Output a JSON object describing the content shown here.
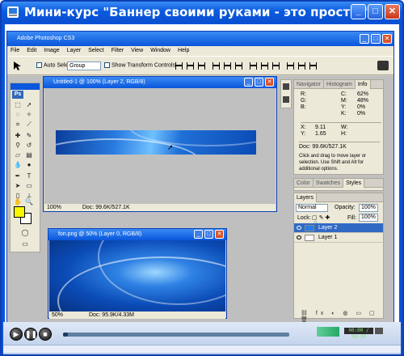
{
  "outer_window": {
    "title": "Мини-курс \"Баннер своими руками - это просто!\"",
    "buttons": [
      "_",
      "□",
      "✕"
    ]
  },
  "photoshop": {
    "title": "Adobe Photoshop CS3",
    "buttons": [
      "_",
      "□",
      "✕"
    ],
    "menu": [
      "File",
      "Edit",
      "Image",
      "Layer",
      "Select",
      "Filter",
      "View",
      "Window",
      "Help"
    ],
    "options": {
      "auto_select_label": "Auto Select",
      "auto_select_value": "Group",
      "show_transform_label": "Show Transform Controls"
    }
  },
  "doc1": {
    "title": "Untitled-1 @ 100% (Layer 2, RGB/8)",
    "zoom": "100%",
    "doc_size": "Doc: 99.6K/527.1K"
  },
  "doc2": {
    "title": "fon.png @ 50% (Layer 0, RGB/8)",
    "zoom": "50%",
    "doc_size": "Doc: 95.9K/4.33M"
  },
  "nav_panel": {
    "tabs": [
      "Navigator",
      "Histogram",
      "Info"
    ],
    "active_tab": 2,
    "info_rows": [
      [
        "R:",
        "C:",
        "62%"
      ],
      [
        "G:",
        "M:",
        "48%"
      ],
      [
        "B:",
        "Y:",
        "0%"
      ],
      [
        "",
        "K:",
        "0%"
      ]
    ],
    "xy": [
      "X:",
      "9.11",
      "W:",
      ""
    ],
    "xy2": [
      "Y:",
      "1.65",
      "H:",
      ""
    ],
    "doc_line": "Doc: 99.6K/527.1K",
    "hint": "Click and drag to move layer or selection. Use Shift and Alt for additional options."
  },
  "style_panel": {
    "tabs": [
      "Color",
      "Swatches",
      "Styles"
    ],
    "active_tab": 2
  },
  "layers_panel": {
    "tabs": [
      "Layers"
    ],
    "blend_mode": "Normal",
    "opacity_label": "Opacity:",
    "opacity_value": "100%",
    "lock_label": "Lock:",
    "fill_label": "Fill:",
    "fill_value": "100%",
    "layers": [
      {
        "name": "Layer 2",
        "selected": true
      },
      {
        "name": "Layer 1",
        "selected": false
      }
    ]
  },
  "player": {
    "time": "00:00 / 08:30",
    "progress": 0.02
  }
}
